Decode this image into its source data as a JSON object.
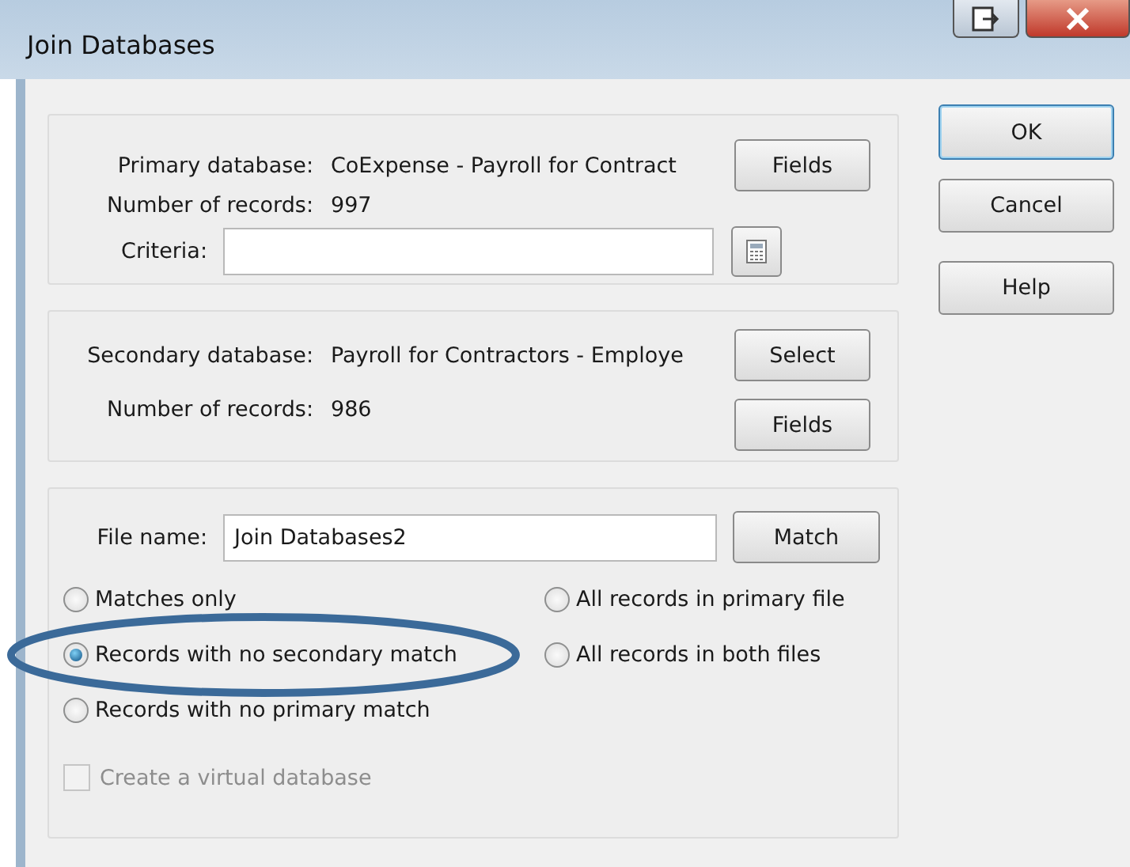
{
  "window": {
    "title": "Join Databases",
    "controls": [
      {
        "kind": "restore"
      },
      {
        "kind": "close"
      }
    ]
  },
  "primary": {
    "label": "Primary database:",
    "value": "CoExpense - Payroll for Contract",
    "records_label": "Number of records:",
    "records": "997",
    "fields_button": "Fields",
    "criteria_label": "Criteria:"
  },
  "secondary": {
    "label": "Secondary database:",
    "value": "Payroll for Contractors - Employe",
    "records_label": "Number of records:",
    "records": "986",
    "select_button": "Select",
    "fields_button": "Fields"
  },
  "output": {
    "file_label": "File name:",
    "file_value": "Join Databases2",
    "match_button": "Match",
    "options": [
      {
        "label": "Matches only",
        "selected": false
      },
      {
        "label": "All records in primary file",
        "selected": false
      },
      {
        "label": "Records with no secondary match",
        "selected": true
      },
      {
        "label": "All records in both files",
        "selected": false
      },
      {
        "label": "Records with no primary match",
        "selected": false
      }
    ],
    "virtual": {
      "label": "Create a virtual database",
      "checked": false,
      "disabled": true
    }
  },
  "buttons": [
    {
      "label": "OK",
      "default": true
    },
    {
      "label": "Cancel",
      "default": false
    },
    {
      "label": "Help",
      "default": false
    }
  ],
  "annotation": {
    "kind": "ellipse"
  }
}
